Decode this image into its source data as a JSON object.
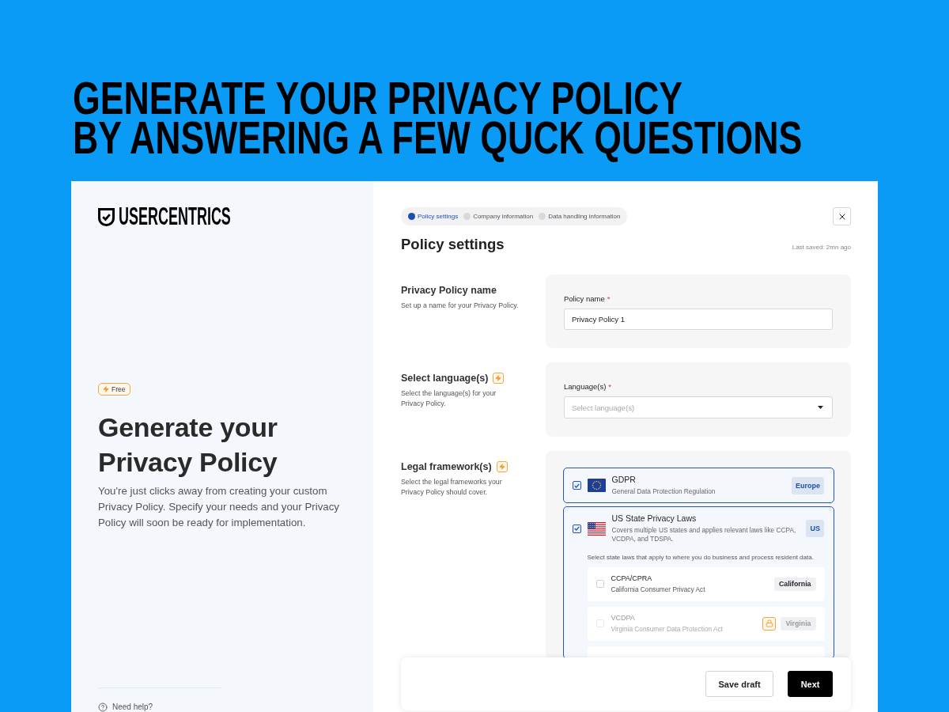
{
  "headline": [
    "GENERATE YOUR PRIVACY POLICY",
    "BY ANSWERING A FEW QUCK QUESTIONS"
  ],
  "intro": {
    "logo": "USERCENTRICS",
    "badge": "Free",
    "title": "Generate your Privacy Policy",
    "description": "You're just clicks away from creating your custom Privacy Policy. Specify your needs and your Privacy Policy will soon be ready for implementation.",
    "help": "Need help?"
  },
  "stepper": [
    {
      "label": "Policy settings",
      "selected": true
    },
    {
      "label": "Company information",
      "selected": false
    },
    {
      "label": "Data handling information",
      "selected": false
    }
  ],
  "title": "Policy settings",
  "last_saved": "Last saved: 2mn ago",
  "sections": [
    {
      "kind": "text",
      "title": "Privacy Policy name",
      "description": "Set up a name for your Privacy Policy.",
      "premium": false,
      "field": {
        "label": "Policy name",
        "marker": "*",
        "value": "Privacy Policy 1"
      }
    },
    {
      "kind": "select",
      "title": "Select language(s)",
      "description": "Select the language(s) for your Privacy Policy.",
      "premium": true,
      "field": {
        "label": "Language(s)",
        "marker": "*",
        "placeholder": "Select language(s)"
      }
    },
    {
      "kind": "frameworks",
      "title": "Legal framework(s)",
      "description": "Select the legal frameworks your Privacy Policy should cover.",
      "premium": true,
      "frameworks": [
        {
          "name": "GDPR",
          "description": "General Data Protection Regulation",
          "region": "Europe",
          "checked": true
        },
        {
          "name": "US State Privacy Laws",
          "description": "Covers multiple US states and applies relevant laws like CCPA, VCDPA, and TDSPA.",
          "region": "US",
          "checked": true,
          "hint": "Select state laws that apply to where you do business and process resident data.",
          "laws": [
            {
              "name": "CCPA/CPRA",
              "description": "California Consumer Privacy Act",
              "region": "California",
              "checked": false,
              "locked": false
            },
            {
              "name": "VCDPA",
              "description": "Virginia Consumer Data Protection Act",
              "region": "Virginia",
              "checked": false,
              "locked": true
            }
          ]
        }
      ]
    }
  ],
  "footer": {
    "buttons": [
      {
        "label": "Save draft",
        "kind": "secondary"
      },
      {
        "label": "Next",
        "kind": "primary"
      }
    ]
  }
}
